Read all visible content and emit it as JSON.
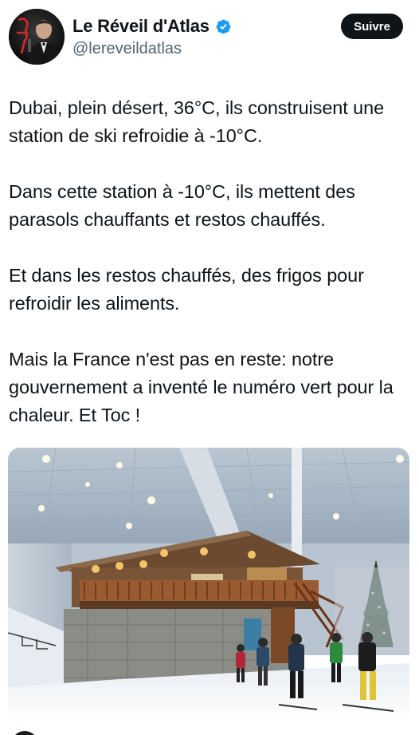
{
  "author": {
    "display_name": "Le Réveil d'Atlas",
    "handle": "@lereveildatlas",
    "avatar_icon": "avatar-man-in-suit",
    "verified_icon": "verified-badge-icon",
    "verified_color": "#1d9bf0"
  },
  "actions": {
    "follow_label": "Suivre"
  },
  "tweet": {
    "paragraphs": [
      "Dubai, plein désert, 36°C, ils construisent une station de ski refroidie à -10°C.",
      "Dans cette station à -10°C, ils mettent des parasols chauffants et restos chauffés.",
      "Et dans les restos chauffés, des frigos pour refroidir les aliments.",
      "Mais la France n'est pas en reste: notre gouvernement a inventé le numéro vert pour la chaleur. Et Toc !"
    ]
  }
}
